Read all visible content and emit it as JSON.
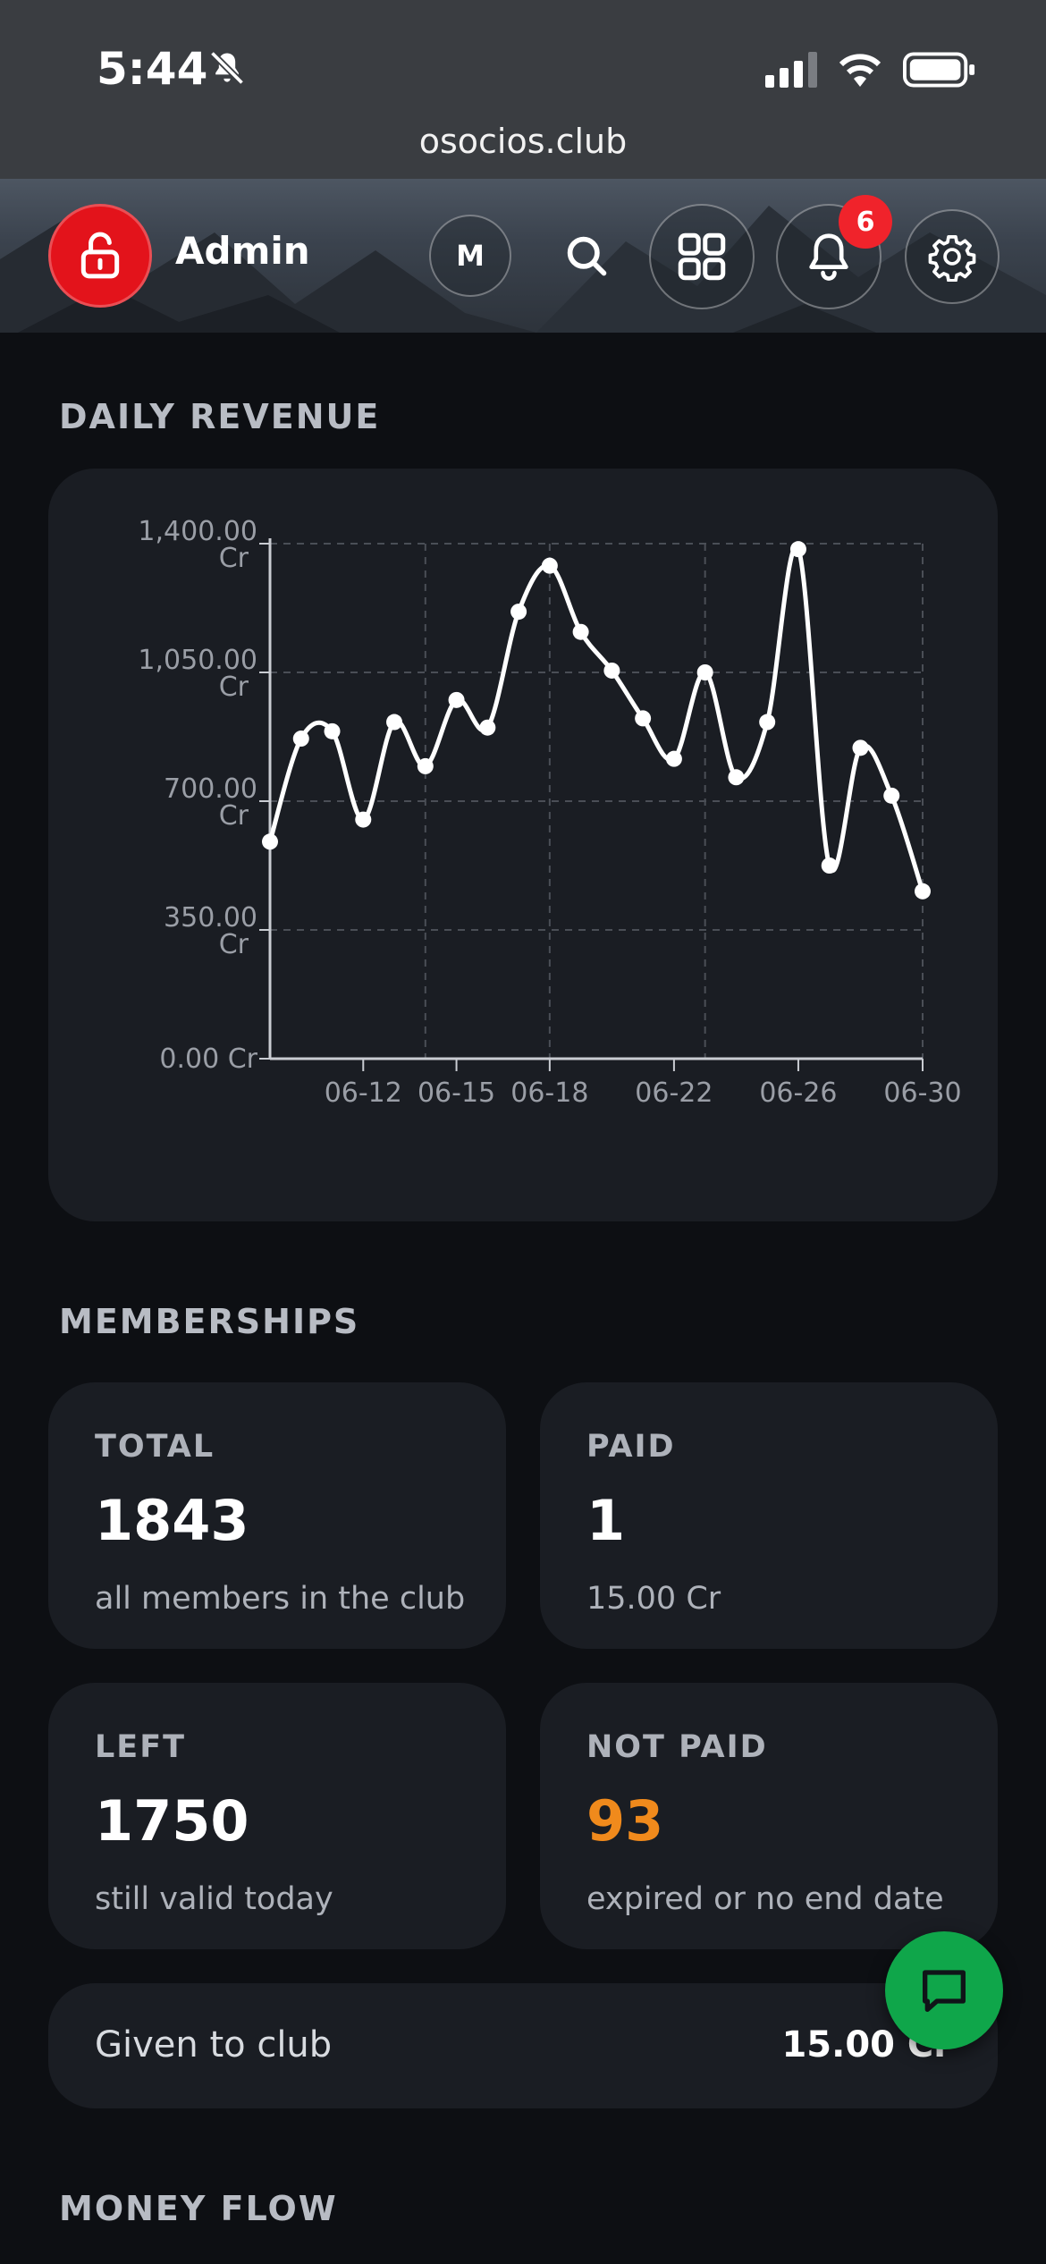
{
  "status_bar": {
    "time": "5:44",
    "url": "osocios.club"
  },
  "header": {
    "user_name": "Admin",
    "avatar_letter": "M",
    "notification_count": "6",
    "icons": [
      "lock-open-icon",
      "search-icon",
      "grid-icon",
      "bell-icon",
      "gear-icon"
    ]
  },
  "sections": {
    "daily_revenue": "DAILY REVENUE",
    "memberships": "MEMBERSHIPS",
    "money_flow": "MONEY FLOW"
  },
  "chart_data": {
    "type": "line",
    "y_ticks": [
      {
        "value": 0,
        "label": "0.00 Cr"
      },
      {
        "value": 350,
        "label": "350.00 Cr"
      },
      {
        "value": 700,
        "label": "700.00 Cr"
      },
      {
        "value": 1050,
        "label": "1,050.00 Cr"
      },
      {
        "value": 1400,
        "label": "1,400.00 Cr"
      }
    ],
    "x_ticks": [
      "06-12",
      "06-15",
      "06-18",
      "06-22",
      "06-26",
      "06-30"
    ],
    "ylim": [
      0,
      1400
    ],
    "xlim": [
      "06-09",
      "06-30"
    ],
    "grid": true,
    "series": [
      {
        "x": [
          "06-09",
          "06-10",
          "06-11",
          "06-12",
          "06-13",
          "06-14",
          "06-15",
          "06-16",
          "06-17",
          "06-18",
          "06-19",
          "06-20",
          "06-21",
          "06-22",
          "06-23",
          "06-24",
          "06-25",
          "06-26",
          "06-27",
          "06-28",
          "06-29",
          "06-30"
        ],
        "values": [
          590,
          870,
          890,
          650,
          915,
          795,
          975,
          900,
          1215,
          1340,
          1160,
          1055,
          925,
          815,
          1050,
          765,
          915,
          1385,
          525,
          845,
          715,
          455
        ]
      }
    ],
    "color": "#ffffff"
  },
  "memberships": [
    {
      "label": "TOTAL",
      "value": "1843",
      "sub": "all members in the club"
    },
    {
      "label": "PAID",
      "value": "1",
      "sub": "15.00 Cr"
    },
    {
      "label": "LEFT",
      "value": "1750",
      "sub": "still valid today"
    },
    {
      "label": "NOT PAID",
      "value": "93",
      "sub": "expired or no end date",
      "accent": "#f08a1c"
    }
  ],
  "given": {
    "label": "Given to club",
    "value": "15.00 Cr"
  },
  "colors": {
    "background": "#0d0f13",
    "card": "#1a1d23",
    "lock_button": "#e3131b",
    "badge": "#f0232b",
    "chat_fab": "#0fa64a",
    "warning": "#f08a1c"
  }
}
